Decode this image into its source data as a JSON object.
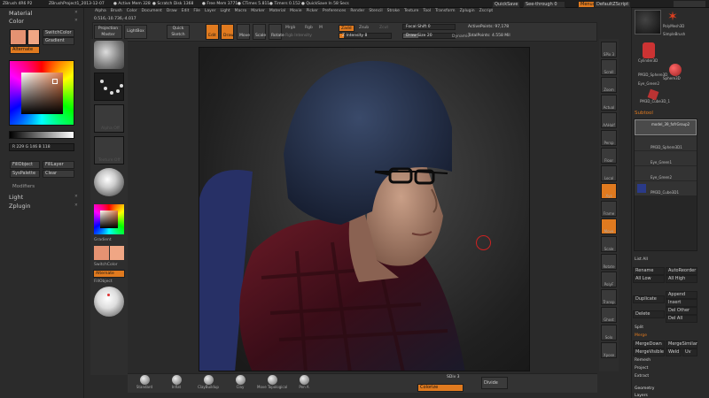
{
  "titlebar": {
    "app": "ZBrush 4R6 P2",
    "project": "ZBrushProject1_2013-12-07",
    "active_mem": "● Active Mem 328",
    "scratch": "● Scratch Disk 1368",
    "free_mem": "● Free Mem 3771",
    "ctimes": "● CTimes 5.811",
    "timers": "● Timers 0.152",
    "quicksave": "● QuickSave In 58 Secs",
    "quicksave_btn": "QuickSave",
    "seethrough": "See-through 0",
    "menus_btn": "Menus",
    "default_script": "DefaultZScript"
  },
  "menu": [
    "Alpha",
    "Brush",
    "Color",
    "Document",
    "Draw",
    "Edit",
    "File",
    "Layer",
    "Light",
    "Macro",
    "Marker",
    "Material",
    "Movie",
    "Picker",
    "Preferences",
    "Render",
    "Stencil",
    "Stroke",
    "Texture",
    "Tool",
    "Transform",
    "Zplugin",
    "Zscript"
  ],
  "coords": "0.516,-10.736,-4.017",
  "top_buttons": {
    "projection_master": "Projection Master",
    "lightbox": "LightBox",
    "quick_sketch": "Quick Sketch",
    "edit": "Edit",
    "draw": "Draw",
    "move": "Move",
    "scale": "Scale",
    "rotate": "Rotate"
  },
  "draw_settings": {
    "mrgb": "Mrgb",
    "rgb": "Rgb",
    "m": "M",
    "rgb_intensity": "Rgb Intensity",
    "zadd": "Zadd",
    "zsub": "Zsub",
    "zcut": "Zcut",
    "z_intensity": "Z Intensity 8",
    "focal_shift": "Focal Shift 0",
    "draw_size": "Draw Size 20",
    "dynamic": "Dynamic",
    "active_points": "ActivePoints: 97,178",
    "total_points": "TotalPoints: 4.558 Mil"
  },
  "left_panel": {
    "material": "Material",
    "color": "Color",
    "switch_color": "SwitchColor",
    "gradient": "Gradient",
    "alternate": "Alternate",
    "fill_object": "FillObject",
    "fill_layer": "FillLayer",
    "syspalette": "SysPalette",
    "clear": "Clear",
    "modifiers": "Modifiers",
    "light": "Light",
    "zplugin": "Zplugin"
  },
  "color_values": "R 229   G 146   B 118",
  "left_tray": {
    "alpha_off": "Alpha Off",
    "texture_off": "Texture Off",
    "gradient": "Gradient",
    "switch_color": "SwitchColor",
    "alternate": "Alternate",
    "fill_object": "FillObject"
  },
  "brushes": [
    "Standard",
    "Inflat",
    "ClayBuildup",
    "Clay",
    "Move Topological",
    "Pen A"
  ],
  "bottom": {
    "sdiv": "SDiv 3",
    "colorize": "Colorize",
    "divide": "Divide"
  },
  "right_icons": [
    "SPix 3",
    "Scroll",
    "Zoom",
    "Actual",
    "AAHalf",
    "Persp",
    "Floor",
    "Local",
    "Xyz",
    "Frame",
    "Move",
    "Scale",
    "Rotate",
    "PolyF",
    "Transp",
    "Ghost",
    "Solo",
    "Xpose"
  ],
  "right_panel": {
    "tools": [
      "PolyMesh3D",
      "SimpleBrush",
      "Cylinder3D",
      "PM3D_Sphere3D",
      "Eye_Green2",
      "Sphere3D",
      "PM3D_Cube3D_1"
    ],
    "subtool_title": "Subtool",
    "subtools": [
      "model_39_fofrGroup2",
      "PM3D_Sphere3D1",
      "Eye_Green1",
      "Eye_Green2",
      "PM3D_Cube3D1"
    ],
    "list_all": "List All",
    "rename": "Rename",
    "autoreorder": "AutoReorder",
    "all_low": "All Low",
    "all_high": "All High",
    "duplicate": "Duplicate",
    "append": "Append",
    "insert": "Insert",
    "delete": "Delete",
    "del_other": "Del Other",
    "del_all": "Del All",
    "split": "Split",
    "merge": "Merge",
    "merge_down": "MergeDown",
    "merge_similar": "MergeSimilar",
    "merge_visible": "MergeVisible",
    "weld": "Weld",
    "uv": "Uv",
    "remesh": "Remesh",
    "project": "Project",
    "extract": "Extract",
    "geometry": "Geometry",
    "layers": "Layers"
  }
}
